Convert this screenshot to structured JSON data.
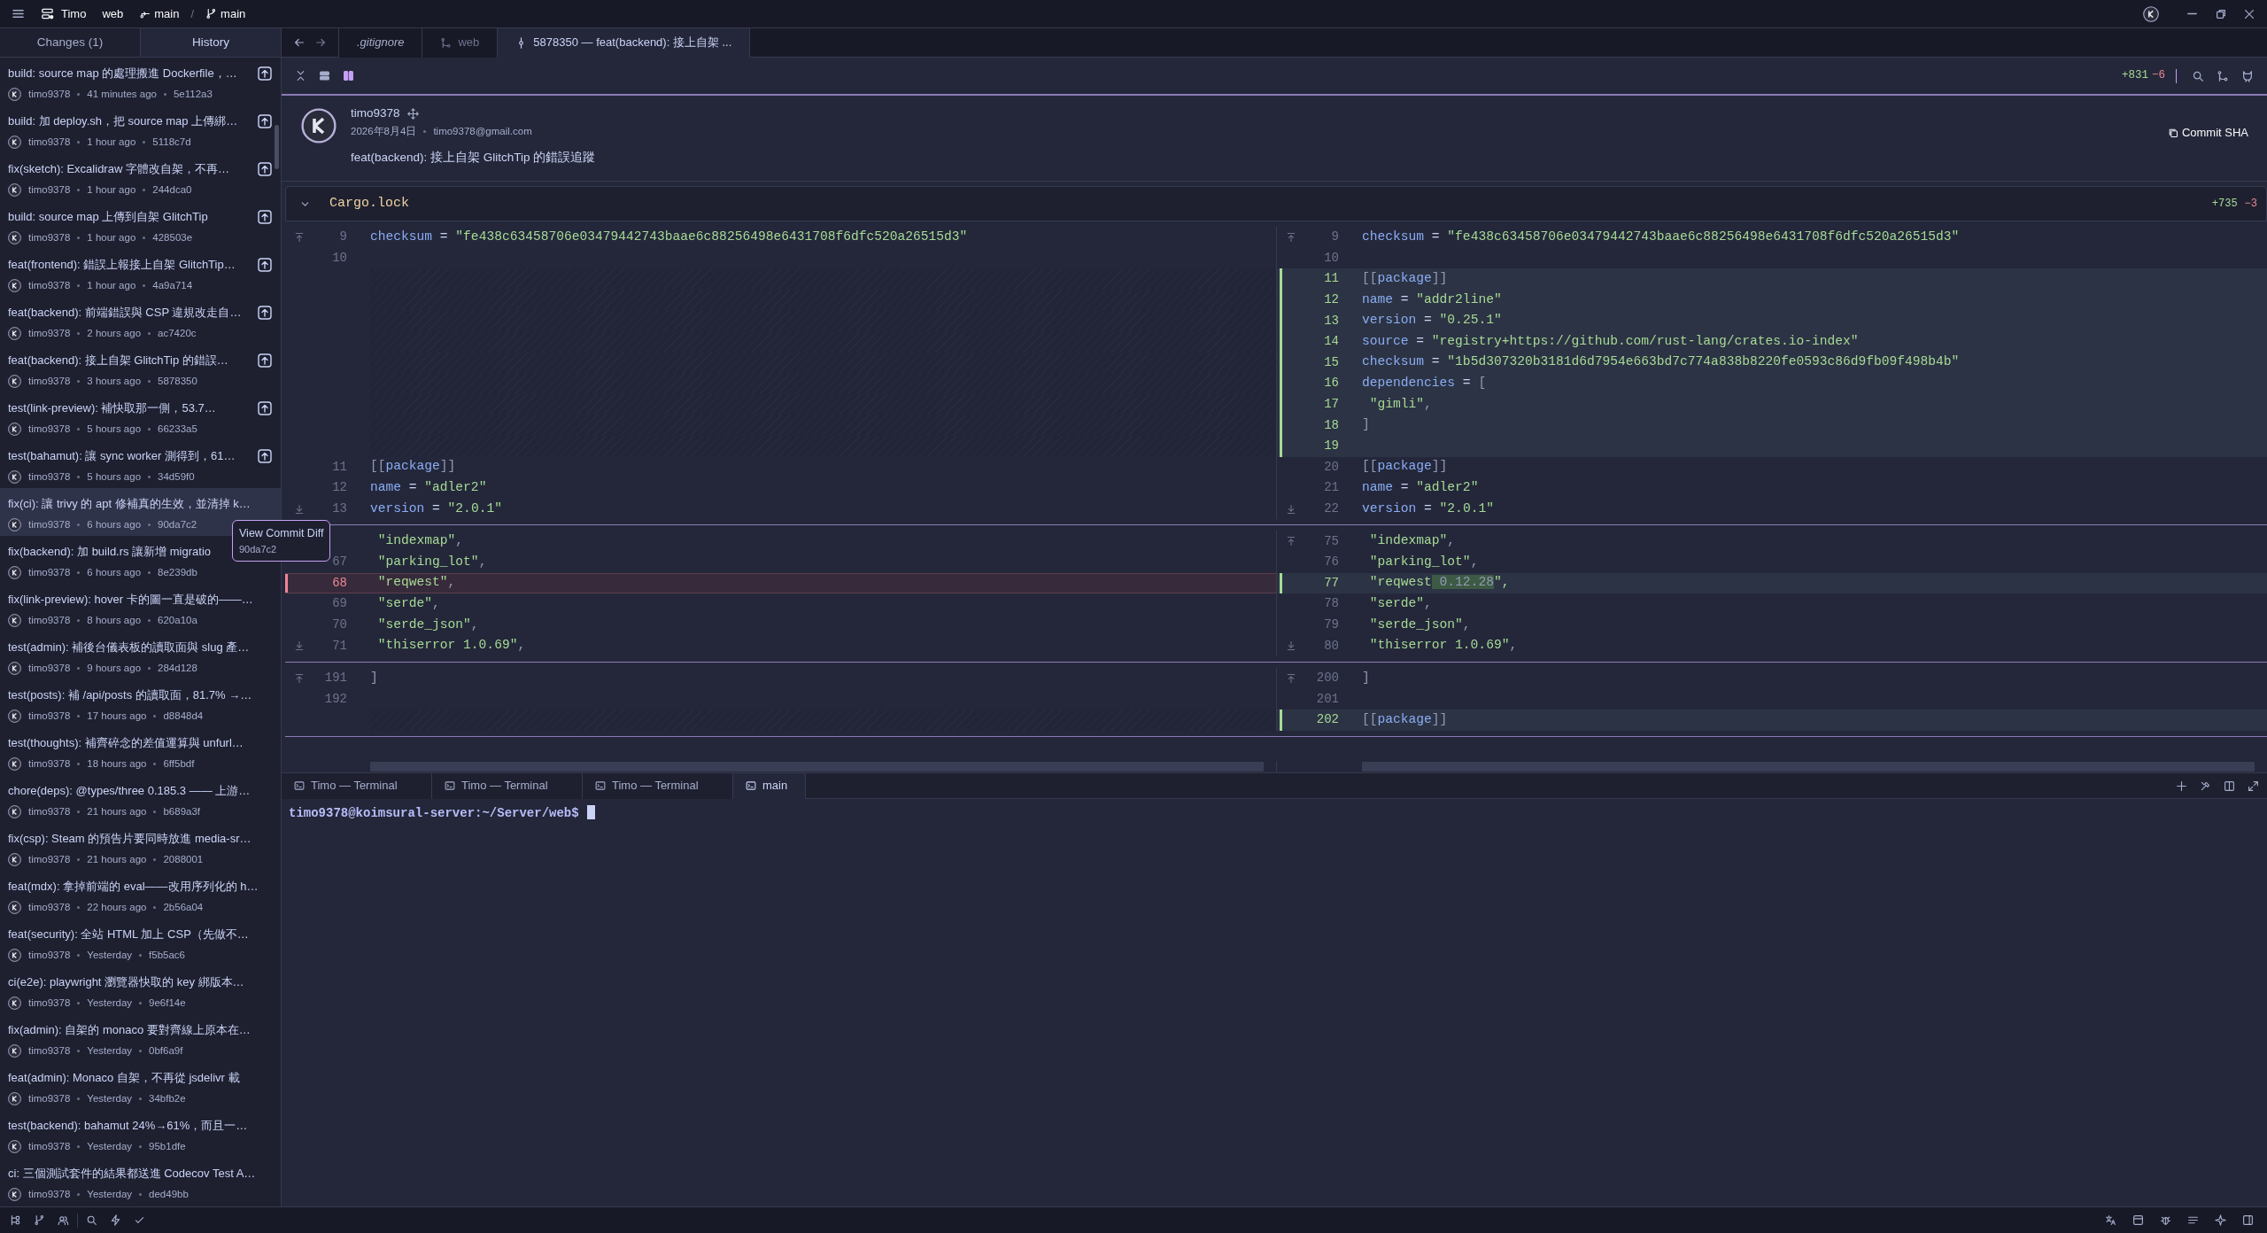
{
  "title_bar": {
    "workspace": "Timo",
    "repo": "web",
    "branch": "main",
    "separator": "/",
    "remote_branch": "main"
  },
  "sidebar": {
    "tabs": [
      {
        "label": "Changes (1)",
        "selected": false
      },
      {
        "label": "History",
        "selected": true
      }
    ],
    "commits": [
      {
        "title": "build: source map 的處理搬進 Dockerfile，…",
        "author": "timo9378",
        "time": "41 minutes ago",
        "sha": "5e112a3",
        "unpushed": true,
        "selected": false
      },
      {
        "title": "build: 加 deploy.sh，把 source map 上傳綁…",
        "author": "timo9378",
        "time": "1 hour ago",
        "sha": "5118c7d",
        "unpushed": true,
        "selected": false
      },
      {
        "title": "fix(sketch): Excalidraw 字體改自架，不再…",
        "author": "timo9378",
        "time": "1 hour ago",
        "sha": "244dca0",
        "unpushed": true,
        "selected": false
      },
      {
        "title": "build: source map 上傳到自架 GlitchTip",
        "author": "timo9378",
        "time": "1 hour ago",
        "sha": "428503e",
        "unpushed": true,
        "selected": false
      },
      {
        "title": "feat(frontend): 錯誤上報接上自架 GlitchTip…",
        "author": "timo9378",
        "time": "1 hour ago",
        "sha": "4a9a714",
        "unpushed": true,
        "selected": false
      },
      {
        "title": "feat(backend): 前端錯誤與 CSP 違規改走自…",
        "author": "timo9378",
        "time": "2 hours ago",
        "sha": "ac7420c",
        "unpushed": true,
        "selected": false
      },
      {
        "title": "feat(backend): 接上自架 GlitchTip 的錯誤…",
        "author": "timo9378",
        "time": "3 hours ago",
        "sha": "5878350",
        "unpushed": true,
        "selected": false
      },
      {
        "title": "test(link-preview): 補快取那一側，53.7…",
        "author": "timo9378",
        "time": "5 hours ago",
        "sha": "66233a5",
        "unpushed": true,
        "selected": false
      },
      {
        "title": "test(bahamut): 讓 sync worker 測得到，61…",
        "author": "timo9378",
        "time": "5 hours ago",
        "sha": "34d59f0",
        "unpushed": true,
        "selected": false
      },
      {
        "title": "fix(ci): 讓 trivy 的 apt 修補真的生效，並清掉 k…",
        "author": "timo9378",
        "time": "6 hours ago",
        "sha": "90da7c2",
        "unpushed": false,
        "selected": true
      },
      {
        "title": "fix(backend): 加 build.rs 讓新增 migratio",
        "author": "timo9378",
        "time": "6 hours ago",
        "sha": "8e239db",
        "unpushed": false,
        "selected": false
      },
      {
        "title": "fix(link-preview): hover 卡的圖一直是破的——…",
        "author": "timo9378",
        "time": "8 hours ago",
        "sha": "620a10a",
        "unpushed": false,
        "selected": false
      },
      {
        "title": "test(admin): 補後台儀表板的讀取面與 slug 產…",
        "author": "timo9378",
        "time": "9 hours ago",
        "sha": "284d128",
        "unpushed": false,
        "selected": false
      },
      {
        "title": "test(posts): 補 /api/posts 的讀取面，81.7% →…",
        "author": "timo9378",
        "time": "17 hours ago",
        "sha": "d8848d4",
        "unpushed": false,
        "selected": false
      },
      {
        "title": "test(thoughts): 補齊碎念的差值運算與 unfurl…",
        "author": "timo9378",
        "time": "18 hours ago",
        "sha": "6ff5bdf",
        "unpushed": false,
        "selected": false
      },
      {
        "title": "chore(deps): @types/three 0.185.3 —— 上游…",
        "author": "timo9378",
        "time": "21 hours ago",
        "sha": "b689a3f",
        "unpushed": false,
        "selected": false
      },
      {
        "title": "fix(csp): Steam 的預告片要同時放進 media-sr…",
        "author": "timo9378",
        "time": "21 hours ago",
        "sha": "2088001",
        "unpushed": false,
        "selected": false
      },
      {
        "title": "feat(mdx): 拿掉前端的 eval——改用序列化的 h…",
        "author": "timo9378",
        "time": "22 hours ago",
        "sha": "2b56a04",
        "unpushed": false,
        "selected": false
      },
      {
        "title": "feat(security): 全站 HTML 加上 CSP（先做不…",
        "author": "timo9378",
        "time": "Yesterday",
        "sha": "f5b5ac6",
        "unpushed": false,
        "selected": false
      },
      {
        "title": "ci(e2e): playwright 瀏覽器快取的 key 綁版本…",
        "author": "timo9378",
        "time": "Yesterday",
        "sha": "9e6f14e",
        "unpushed": false,
        "selected": false
      },
      {
        "title": "fix(admin): 自架的 monaco 要對齊線上原本在…",
        "author": "timo9378",
        "time": "Yesterday",
        "sha": "0bf6a9f",
        "unpushed": false,
        "selected": false
      },
      {
        "title": "feat(admin): Monaco 自架，不再從 jsdelivr 載",
        "author": "timo9378",
        "time": "Yesterday",
        "sha": "34bfb2e",
        "unpushed": false,
        "selected": false
      },
      {
        "title": "test(backend): bahamut 24%→61%，而且一…",
        "author": "timo9378",
        "time": "Yesterday",
        "sha": "95b1dfe",
        "unpushed": false,
        "selected": false
      },
      {
        "title": "ci: 三個測試套件的結果都送進 Codecov Test A…",
        "author": "timo9378",
        "time": "Yesterday",
        "sha": "ded49bb",
        "unpushed": false,
        "selected": false
      }
    ],
    "tooltip": {
      "title": "View Commit Diff",
      "sha": "90da7c2"
    }
  },
  "editor_tabs": [
    {
      "label": ".gitignore",
      "kind": "file",
      "selected": false
    },
    {
      "label": "web",
      "kind": "repo",
      "selected": false
    },
    {
      "label": "5878350 — feat(backend): 接上自架 ...",
      "kind": "commit",
      "selected": true
    }
  ],
  "toolbar": {
    "views": [
      {
        "kind": "unified",
        "selected": false
      },
      {
        "kind": "split",
        "selected": true
      }
    ],
    "additions": "+831",
    "deletions": "−6"
  },
  "commit": {
    "author": "timo9378",
    "date": "2026年8月4日",
    "email": "timo9378@gmail.com",
    "message": "feat(backend): 接上自架 GlitchTip 的錯誤追蹤",
    "copy_label": "Commit SHA"
  },
  "file": {
    "name": "Cargo.lock",
    "expanded": true,
    "additions": "+735",
    "deletions": "−3",
    "hunks": [
      {
        "rows": [
          {
            "left": {
              "kind": "context",
              "num": "9",
              "code": "checksum = \"fe438c63458706e03479442743baae6c88256498e6431708f6dfc520a26515d3\"",
              "expand_up": true
            },
            "right": {
              "kind": "context",
              "num": "9",
              "code": "checksum = \"fe438c63458706e03479442743baae6c88256498e6431708f6dfc520a26515d3\"",
              "expand_up": true
            }
          },
          {
            "left": {
              "kind": "context",
              "num": "10"
            },
            "right": {
              "kind": "context",
              "num": "10"
            }
          },
          {
            "left": {
              "kind": "filler"
            },
            "right": {
              "kind": "added",
              "num": "11",
              "code": "[[package]]"
            }
          },
          {
            "left": {
              "kind": "filler"
            },
            "right": {
              "kind": "added",
              "num": "12",
              "code": "name = \"addr2line\""
            }
          },
          {
            "left": {
              "kind": "filler"
            },
            "right": {
              "kind": "added",
              "num": "13",
              "code": "version = \"0.25.1\""
            }
          },
          {
            "left": {
              "kind": "filler"
            },
            "right": {
              "kind": "added",
              "num": "14",
              "code": "source = \"registry+https://github.com/rust-lang/crates.io-index\""
            }
          },
          {
            "left": {
              "kind": "filler"
            },
            "right": {
              "kind": "added",
              "num": "15",
              "code": "checksum = \"1b5d307320b3181d6d7954e663bd7c774a838b8220fe0593c86d9fb09f498b4b\""
            }
          },
          {
            "left": {
              "kind": "filler"
            },
            "right": {
              "kind": "added",
              "num": "16",
              "code": "dependencies = ["
            }
          },
          {
            "left": {
              "kind": "filler"
            },
            "right": {
              "kind": "added",
              "num": "17",
              "code": " \"gimli\","
            }
          },
          {
            "left": {
              "kind": "filler"
            },
            "right": {
              "kind": "added",
              "num": "18",
              "code": "]"
            }
          },
          {
            "left": {
              "kind": "filler"
            },
            "right": {
              "kind": "added",
              "num": "19"
            }
          },
          {
            "left": {
              "kind": "context",
              "num": "11",
              "code": "[[package]]"
            },
            "right": {
              "kind": "context",
              "num": "20",
              "code": "[[package]]"
            }
          },
          {
            "left": {
              "kind": "context",
              "num": "12",
              "code": "name = \"adler2\""
            },
            "right": {
              "kind": "context",
              "num": "21",
              "code": "name = \"adler2\""
            }
          },
          {
            "left": {
              "kind": "context",
              "num": "13",
              "code": "version = \"2.0.1\"",
              "expand_down": true
            },
            "right": {
              "kind": "context",
              "num": "22",
              "code": "version = \"2.0.1\"",
              "expand_down": true
            }
          }
        ]
      },
      {
        "rows": [
          {
            "left": {
              "kind": "context",
              "code": " \"indexmap\","
            },
            "right": {
              "kind": "context",
              "num": "75",
              "code": " \"indexmap\",",
              "expand_up": true
            }
          },
          {
            "left": {
              "kind": "context",
              "num": "67",
              "code": " \"parking_lot\","
            },
            "right": {
              "kind": "context",
              "num": "76",
              "code": " \"parking_lot\","
            }
          },
          {
            "left": {
              "kind": "removed",
              "num": "68",
              "code": " \"reqwest\","
            },
            "right": {
              "kind": "added",
              "num": "77",
              "parts": [
                {
                  "text": " \"reqwest",
                  "changed": false
                },
                {
                  "text": " 0.12.28",
                  "changed": true
                },
                {
                  "text": "\",",
                  "changed": false
                }
              ]
            }
          },
          {
            "left": {
              "kind": "context",
              "num": "69",
              "code": " \"serde\","
            },
            "right": {
              "kind": "context",
              "num": "78",
              "code": " \"serde\","
            }
          },
          {
            "left": {
              "kind": "context",
              "num": "70",
              "code": " \"serde_json\","
            },
            "right": {
              "kind": "context",
              "num": "79",
              "code": " \"serde_json\","
            }
          },
          {
            "left": {
              "kind": "context",
              "num": "71",
              "code": " \"thiserror 1.0.69\",",
              "expand_down": true
            },
            "right": {
              "kind": "context",
              "num": "80",
              "code": " \"thiserror 1.0.69\",",
              "expand_down": true
            }
          }
        ]
      },
      {
        "rows": [
          {
            "left": {
              "kind": "context",
              "num": "191",
              "code": "]",
              "expand_up": true
            },
            "right": {
              "kind": "context",
              "num": "200",
              "code": "]",
              "expand_up": true
            }
          },
          {
            "left": {
              "kind": "context",
              "num": "192"
            },
            "right": {
              "kind": "context",
              "num": "201"
            }
          },
          {
            "left": {
              "kind": "filler"
            },
            "right": {
              "kind": "added",
              "num": "202",
              "code": "[[package]]"
            }
          }
        ]
      }
    ]
  },
  "terminal": {
    "tabs": [
      {
        "label": "Timo — Terminal",
        "selected": false
      },
      {
        "label": "Timo — Terminal",
        "selected": false
      },
      {
        "label": "Timo — Terminal",
        "selected": false
      },
      {
        "label": "main",
        "selected": true
      }
    ],
    "prompt": "timo9378@koimsural-server:~/Server/web$"
  }
}
